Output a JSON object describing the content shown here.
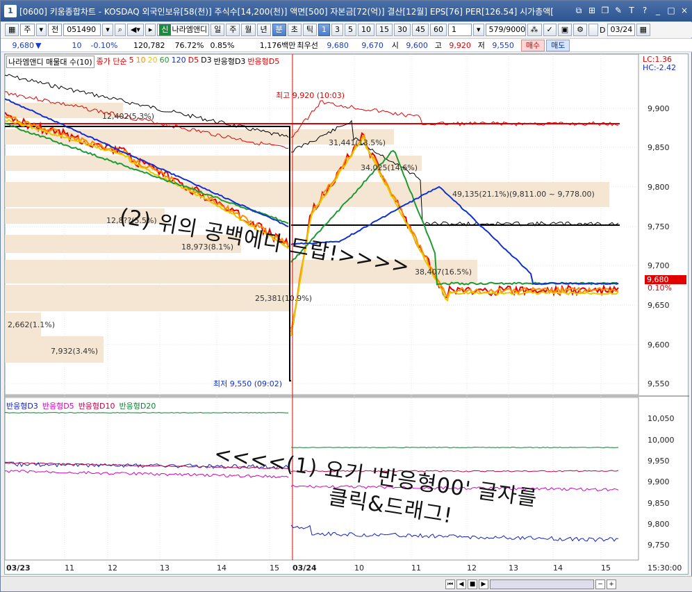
{
  "title": {
    "app_number": "1",
    "text": "[0600] 키움종합차트 - KOSDAQ 외국인보유[58(천)] 주식수[14,200(천)] 액면[500] 자본금[72(억)] 결산[12월] EPS[76] PER[126.54] 시가총액["
  },
  "toolbar1": {
    "market": "주",
    "type": "전",
    "code": "051490",
    "name": "나라엠앤디",
    "shin": "신",
    "periods": [
      "일",
      "주",
      "월",
      "년",
      "분",
      "초",
      "틱"
    ],
    "minutes": [
      "1",
      "3",
      "5",
      "10",
      "15",
      "30",
      "45",
      "60"
    ],
    "count": "1",
    "range": "579/9000",
    "d_label": "D",
    "date": "03/24"
  },
  "quote": {
    "price": "9,680",
    "arrow": "▼",
    "change": "10",
    "rate": "-0.10%",
    "volume": "120,782",
    "vol_ratio": "76.72%",
    "turnover": "0.85%",
    "amount": "1,176백만",
    "label_best": "최우선",
    "ask": "9,680",
    "bid": "9,670",
    "open_label": "시",
    "open": "9,600",
    "high_label": "고",
    "high": "9,920",
    "low_label": "저",
    "low": "9,550",
    "buy": "매수",
    "sell": "매도"
  },
  "legend_top": {
    "volume_profile": "나라엠앤디 매물대 수(10)",
    "close_label": "종가 단순",
    "ma5": "5",
    "ma10": "10",
    "ma20": "20",
    "ma60": "60",
    "ma120": "120",
    "d5": "D5",
    "d3": "D3",
    "r3": "반응형D3",
    "r5": "반응형D5",
    "lc": "LC:1.36",
    "hc": "HC:-2.42"
  },
  "legend_bottom": {
    "r3": "반응형D3",
    "r5": "반응형D5",
    "r10": "반응형D10",
    "r20": "반응형D20"
  },
  "yaxis_top": [
    "9,900",
    "9,850",
    "9,800",
    "9,750",
    "9,700",
    "9,650",
    "9,600",
    "9,550"
  ],
  "yaxis_bottom": [
    "10,050",
    "10,000",
    "9,950",
    "9,900",
    "9,850",
    "9,800",
    "9,750"
  ],
  "current_price_tag": "9,680",
  "current_rate_tag": "0.10%",
  "xaxis": [
    "03/23",
    "11",
    "12",
    "13",
    "14",
    "15",
    "03/24",
    "10",
    "11",
    "12",
    "13",
    "14",
    "15"
  ],
  "xaxis_time": "15:30:00",
  "volume_profile": [
    "12,402(5.3%)",
    "31,441(13.5%)",
    "34,025(14.6%)",
    "49,135(21.1%)(9,811.00 ~ 9,778.00)",
    "12,8??(5.5%)",
    "18,973(8.1%)",
    "38,407(16.5%)",
    "25,381(10.9%)",
    "2,662(1.1%)",
    "7,932(3.4%)"
  ],
  "annotations": {
    "high": "최고 9,920 (10:03)",
    "low": "최저 9,550 (09:02)"
  },
  "handwriting": {
    "note2": "(2) 위의 공백에다 드랍!>>>>",
    "note1_line1": "<<<<(1) 요기 '반응형00' 글자를",
    "note1_line2": "클릭&드래그!"
  },
  "colors": {
    "ma5": "#e60000",
    "ma10": "#ff8c00",
    "ma20": "#e6c800",
    "ma60": "#1e9a32",
    "ma120": "#1030d0",
    "d5": "#e00000",
    "d3": "#000000",
    "r3": "#1020c0",
    "r5": "#d000c0",
    "r10": "#c00040",
    "r20": "#108030",
    "volume_profile_bg": "#f5e6d3"
  }
}
